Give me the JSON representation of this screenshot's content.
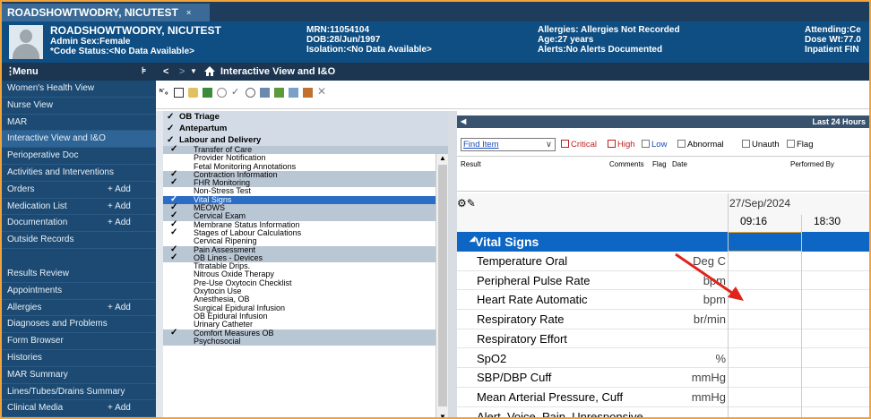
{
  "tab": {
    "title": "ROADSHOWTWODRY, NICUTEST",
    "close": "×"
  },
  "banner": {
    "c1": [
      "ROADSHOWTWODRY, NICUTEST",
      "Admin Sex:Female",
      "*Code Status:<No Data Available>"
    ],
    "c2": [
      "MRN:11054104",
      "DOB:28/Jun/1997",
      "Isolation:<No Data Available>"
    ],
    "c3": [
      "Allergies: Allergies Not Recorded",
      "Age:27 years",
      "Alerts:No Alerts Documented"
    ],
    "c4": [
      "Attending:Ce",
      "Dose Wt:77.0",
      "Inpatient FIN"
    ]
  },
  "nav": {
    "menu_label": "Menu",
    "pin": "⊧",
    "back": "<",
    "fwd": ">",
    "title": "Interactive View and I&O"
  },
  "menu": [
    {
      "label": "Women's Health View",
      "add": ""
    },
    {
      "label": "Nurse View",
      "add": ""
    },
    {
      "label": "MAR",
      "add": ""
    },
    {
      "label": "Interactive View and I&O",
      "add": ""
    },
    {
      "label": "Perioperative Doc",
      "add": ""
    },
    {
      "label": "Activities and Interventions",
      "add": ""
    },
    {
      "label": "Orders",
      "add": "+ Add"
    },
    {
      "label": "Medication List",
      "add": "+ Add"
    },
    {
      "label": "Documentation",
      "add": "+ Add"
    },
    {
      "label": "Outside Records",
      "add": ""
    },
    {
      "label": "Results Review",
      "add": ""
    },
    {
      "label": "Appointments",
      "add": ""
    },
    {
      "label": "Allergies",
      "add": "+ Add"
    },
    {
      "label": "Diagnoses and Problems",
      "add": ""
    },
    {
      "label": "Form Browser",
      "add": ""
    },
    {
      "label": "Histories",
      "add": ""
    },
    {
      "label": "MAR Summary",
      "add": ""
    },
    {
      "label": "Lines/Tubes/Drains Summary",
      "add": ""
    },
    {
      "label": "Clinical Media",
      "add": "+ Add"
    }
  ],
  "tree": {
    "groups": [
      "OB Triage",
      "Antepartum",
      "Labour and Delivery"
    ],
    "items": [
      {
        "label": "Transfer of Care",
        "check": "✓",
        "shade": true
      },
      {
        "label": "Provider Notification",
        "check": "",
        "shade": false
      },
      {
        "label": "Fetal Monitoring Annotations",
        "check": "",
        "shade": false
      },
      {
        "label": "Contraction Information",
        "check": "✓",
        "shade": true
      },
      {
        "label": "FHR Monitoring",
        "check": "✓",
        "shade": true
      },
      {
        "label": "Non-Stress Test",
        "check": "",
        "shade": false
      },
      {
        "label": "Vital Signs",
        "check": "✓",
        "shade": false,
        "sel": true
      },
      {
        "label": "MEOWS",
        "check": "✓",
        "shade": true
      },
      {
        "label": "Cervical Exam",
        "check": "✓",
        "shade": true
      },
      {
        "label": "Membrane Status Information",
        "check": "✓",
        "shade": false
      },
      {
        "label": "Stages of Labour Calculations",
        "check": "✓",
        "shade": false
      },
      {
        "label": "Cervical Ripening",
        "check": "",
        "shade": false
      },
      {
        "label": "Pain Assessment",
        "check": "✓",
        "shade": true
      },
      {
        "label": "OB Lines - Devices",
        "check": "✓",
        "shade": true
      },
      {
        "label": "Titratable Drips.",
        "check": "",
        "shade": false
      },
      {
        "label": "Nitrous Oxide Therapy",
        "check": "",
        "shade": false
      },
      {
        "label": "Pre-Use Oxytocin Checklist",
        "check": "",
        "shade": false
      },
      {
        "label": "Oxytocin Use",
        "check": "",
        "shade": false
      },
      {
        "label": "Anesthesia, OB",
        "check": "",
        "shade": false
      },
      {
        "label": "Surgical Epidural Infusion",
        "check": "",
        "shade": false
      },
      {
        "label": "OB Epidural Infusion",
        "check": "",
        "shade": false
      },
      {
        "label": "Urinary Catheter",
        "check": "",
        "shade": false
      },
      {
        "label": "Comfort Measures OB",
        "check": "✓",
        "shade": true
      },
      {
        "label": "Psychosocial",
        "check": "",
        "shade": true
      }
    ]
  },
  "right": {
    "header": "Last 24 Hours",
    "find": "Find Item",
    "filters": [
      "Critical",
      "High",
      "Low",
      "Abnormal",
      "Unauth",
      "Flag"
    ],
    "columns": [
      "Result",
      "Comments",
      "Flag",
      "Date",
      "Performed By"
    ],
    "date": "27/Sep/2024",
    "times": [
      "09:16",
      "18:30"
    ],
    "section": "Vital Signs",
    "rows": [
      {
        "name": "Temperature Oral",
        "unit": "Deg C"
      },
      {
        "name": "Peripheral Pulse Rate",
        "unit": "bpm"
      },
      {
        "name": "Heart Rate Automatic",
        "unit": "bpm"
      },
      {
        "name": "Respiratory Rate",
        "unit": "br/min"
      },
      {
        "name": "Respiratory Effort",
        "unit": ""
      },
      {
        "name": "SpO2",
        "unit": "%"
      },
      {
        "name": "SBP/DBP Cuff",
        "unit": "mmHg"
      },
      {
        "name": "Mean Arterial Pressure, Cuff",
        "unit": "mmHg"
      },
      {
        "name": "Alert, Voice, Pain, Unresponsive",
        "unit": ""
      }
    ]
  },
  "colors": {
    "banner": "#0f4e82",
    "menu": "#1c4a72",
    "section": "#0d66c4",
    "arrow": "#e0231b",
    "frame": "#f2a33a"
  }
}
